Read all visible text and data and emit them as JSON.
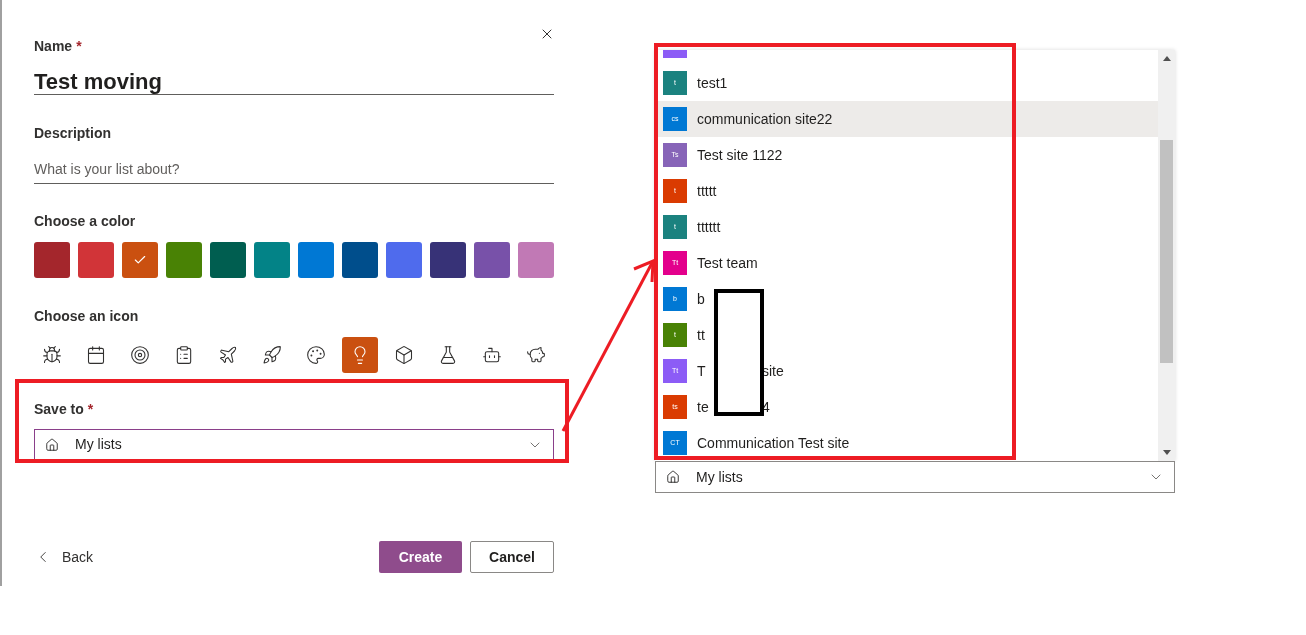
{
  "name_field": {
    "label": "Name",
    "required_mark": "*",
    "value": "Test moving"
  },
  "description_field": {
    "label": "Description",
    "placeholder": "What is your list about?"
  },
  "color_section": {
    "label": "Choose a color",
    "colors": [
      {
        "color": "#a4262c",
        "selected": false
      },
      {
        "color": "#d13438",
        "selected": false
      },
      {
        "color": "#ca5010",
        "selected": true
      },
      {
        "color": "#498205",
        "selected": false
      },
      {
        "color": "#005e50",
        "selected": false
      },
      {
        "color": "#038387",
        "selected": false
      },
      {
        "color": "#0078d4",
        "selected": false
      },
      {
        "color": "#004e8c",
        "selected": false
      },
      {
        "color": "#4f6bed",
        "selected": false
      },
      {
        "color": "#373277",
        "selected": false
      },
      {
        "color": "#7851a9",
        "selected": false
      },
      {
        "color": "#c179b5",
        "selected": false
      }
    ]
  },
  "icon_section": {
    "label": "Choose an icon",
    "icons": [
      {
        "kind": "bug",
        "selected": false
      },
      {
        "kind": "calendar",
        "selected": false
      },
      {
        "kind": "target",
        "selected": false
      },
      {
        "kind": "clipboard",
        "selected": false
      },
      {
        "kind": "plane",
        "selected": false
      },
      {
        "kind": "rocket",
        "selected": false
      },
      {
        "kind": "palette",
        "selected": false
      },
      {
        "kind": "lightbulb",
        "selected": true
      },
      {
        "kind": "box",
        "selected": false
      },
      {
        "kind": "flask",
        "selected": false
      },
      {
        "kind": "robot",
        "selected": false
      },
      {
        "kind": "piggy-bank",
        "selected": false
      }
    ]
  },
  "save_to": {
    "label": "Save to",
    "required_mark": "*",
    "value": "My lists"
  },
  "buttons": {
    "back": "Back",
    "create": "Create",
    "cancel": "Cancel"
  },
  "dropdown": {
    "items": [
      {
        "kind": "partial",
        "color": "#8c5cf6",
        "selected": false
      },
      {
        "kind": "site",
        "initials": "t",
        "label": "test1",
        "color": "#1b827f",
        "selected": false
      },
      {
        "kind": "site",
        "initials": "cs",
        "label": "communication site22",
        "color": "#0078d4",
        "selected": true
      },
      {
        "kind": "site",
        "initials": "Ts",
        "label": "Test site 1122",
        "color": "#8764b8",
        "selected": false
      },
      {
        "kind": "site",
        "initials": "t",
        "label": "ttttt",
        "color": "#da3b01",
        "selected": false
      },
      {
        "kind": "site",
        "initials": "t",
        "label": "tttttt",
        "color": "#1b827f",
        "selected": false
      },
      {
        "kind": "site",
        "initials": "Tt",
        "label": "Test team",
        "color": "#e3008c",
        "selected": false
      },
      {
        "kind": "site",
        "initials": "b",
        "label": "b",
        "color": "#0078d4",
        "selected": false
      },
      {
        "kind": "site",
        "initials": "t",
        "label": "tt",
        "color": "#498205",
        "selected": false
      },
      {
        "kind": "site",
        "initials": "Tt",
        "label": "T",
        "label_after": "site",
        "color": "#8c5cf6",
        "selected": false
      },
      {
        "kind": "site",
        "initials": "ts",
        "label": "te",
        "label_after": "4",
        "color": "#da3b01",
        "selected": false
      },
      {
        "kind": "site",
        "initials": "CT",
        "label": "Communication Test site",
        "color": "#0078d4",
        "selected": false
      }
    ],
    "field_value": "My lists"
  }
}
